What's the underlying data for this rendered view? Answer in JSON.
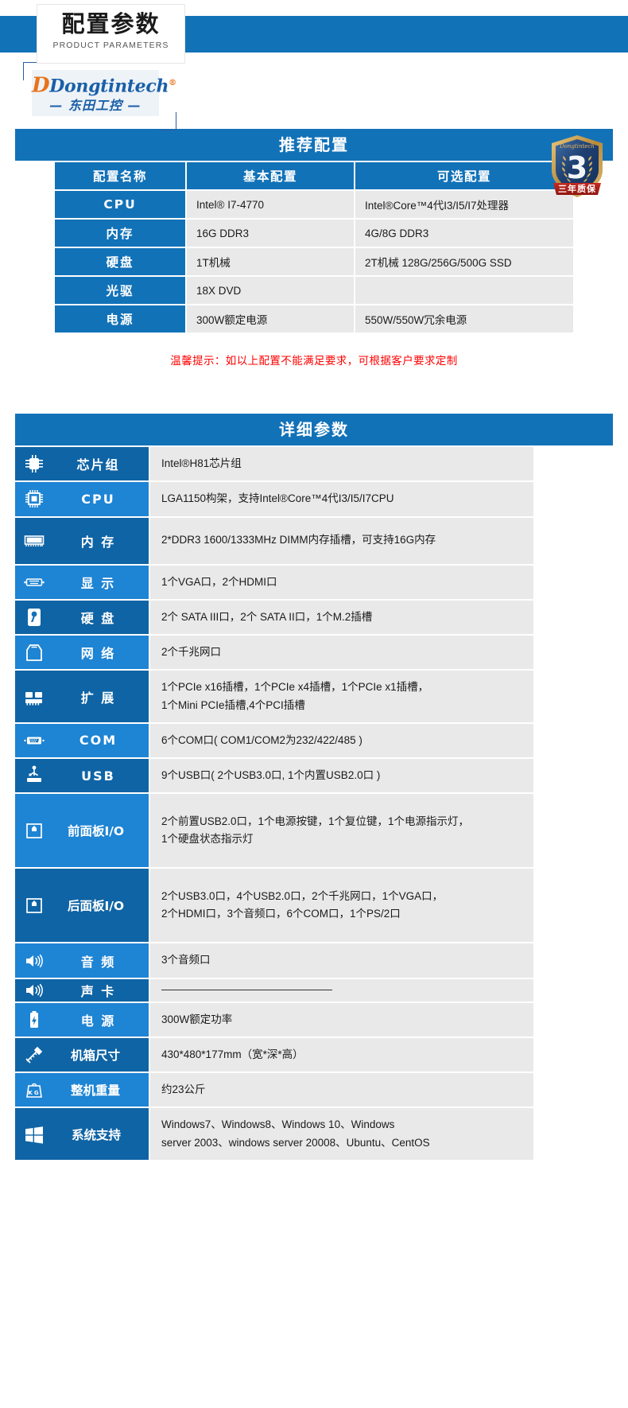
{
  "header": {
    "title_cn": "配置参数",
    "title_en": "PRODUCT PARAMETERS",
    "brand_name": "Dongtintech",
    "brand_reg": "®",
    "brand_cn": "— 东田工控 —",
    "badge_number": "3",
    "badge_ribbon": "三年质保",
    "badge_brand": "Dongtintech",
    "accent_color": "#1272b8",
    "label_dark_color": "#0f64a5",
    "label_light_color": "#1e84d4",
    "value_bg_color": "#e9e9e9",
    "notice_color": "#ff0000"
  },
  "recommended": {
    "title": "推荐配置",
    "columns": [
      "配置名称",
      "基本配置",
      "可选配置"
    ],
    "rows": [
      {
        "name": "CPU",
        "basic": "Intel® I7-4770",
        "optional": "Intel®Core™4代I3/I5/I7处理器"
      },
      {
        "name": "内存",
        "basic": "16G DDR3",
        "optional": "4G/8G DDR3"
      },
      {
        "name": "硬盘",
        "basic": "1T机械",
        "optional": "2T机械 128G/256G/500G SSD"
      },
      {
        "name": "光驱",
        "basic": "18X DVD",
        "optional": ""
      },
      {
        "name": "电源",
        "basic": "300W额定电源",
        "optional": "550W/550W冗余电源"
      }
    ],
    "notice": "温馨提示：如以上配置不能满足要求，可根据客户要求定制"
  },
  "detail": {
    "title": "详细参数",
    "rows": [
      {
        "icon": "chipset-icon",
        "label": "芯片组",
        "value": "Intel®H81芯片组"
      },
      {
        "icon": "cpu-icon",
        "label": "CPU",
        "value": "LGA1150构架，支持Intel®Core™4代I3/I5/I7CPU"
      },
      {
        "icon": "memory-icon",
        "label": "内 存",
        "value": "2*DDR3 1600/1333MHz DIMM内存插槽，可支持16G内存"
      },
      {
        "icon": "display-icon",
        "label": "显 示",
        "value": "1个VGA口，2个HDMI口"
      },
      {
        "icon": "harddisk-icon",
        "label": "硬 盘",
        "value": "2个 SATA III口，2个 SATA II口，1个M.2插槽"
      },
      {
        "icon": "network-icon",
        "label": "网 络",
        "value": "2个千兆网口"
      },
      {
        "icon": "expansion-icon",
        "label": "扩 展",
        "value_line1": "1个PCIe x16插槽，1个PCIe x4插槽，1个PCIe x1插槽，",
        "value_line2": "1个Mini PCIe插槽,4个PCI插槽"
      },
      {
        "icon": "com-port-icon",
        "label": "COM",
        "value": "6个COM口( COM1/COM2为232/422/485 )"
      },
      {
        "icon": "usb-icon",
        "label": "USB",
        "value": "9个USB口( 2个USB3.0口, 1个内置USB2.0口 )"
      },
      {
        "icon": "front-panel-icon",
        "label": "前面板I/O",
        "value_line1": "2个前置USB2.0口，1个电源按键，1个复位键，1个电源指示灯，",
        "value_line2": "1个硬盘状态指示灯"
      },
      {
        "icon": "rear-panel-icon",
        "label": "后面板I/O",
        "value_line1": "2个USB3.0口，4个USB2.0口，2个千兆网口，1个VGA口，",
        "value_line2": "2个HDMI口，3个音频口，6个COM口，1个PS/2口"
      },
      {
        "icon": "audio-icon",
        "label": "音 频",
        "value": "3个音频口"
      },
      {
        "icon": "soundcard-icon",
        "label": "声 卡",
        "value": ""
      },
      {
        "icon": "power-icon",
        "label": "电 源",
        "value": "300W额定功率"
      },
      {
        "icon": "chassis-size-icon",
        "label": "机箱尺寸",
        "value": "430*480*177mm（宽*深*高）"
      },
      {
        "icon": "weight-icon",
        "label": "整机重量",
        "value": "约23公斤"
      },
      {
        "icon": "windows-icon",
        "label": "系统支持",
        "value_line1": "Windows7、Windows8、Windows 10、Windows",
        "value_line2": "server 2003、windows server 20008、Ubuntu、CentOS"
      }
    ]
  }
}
